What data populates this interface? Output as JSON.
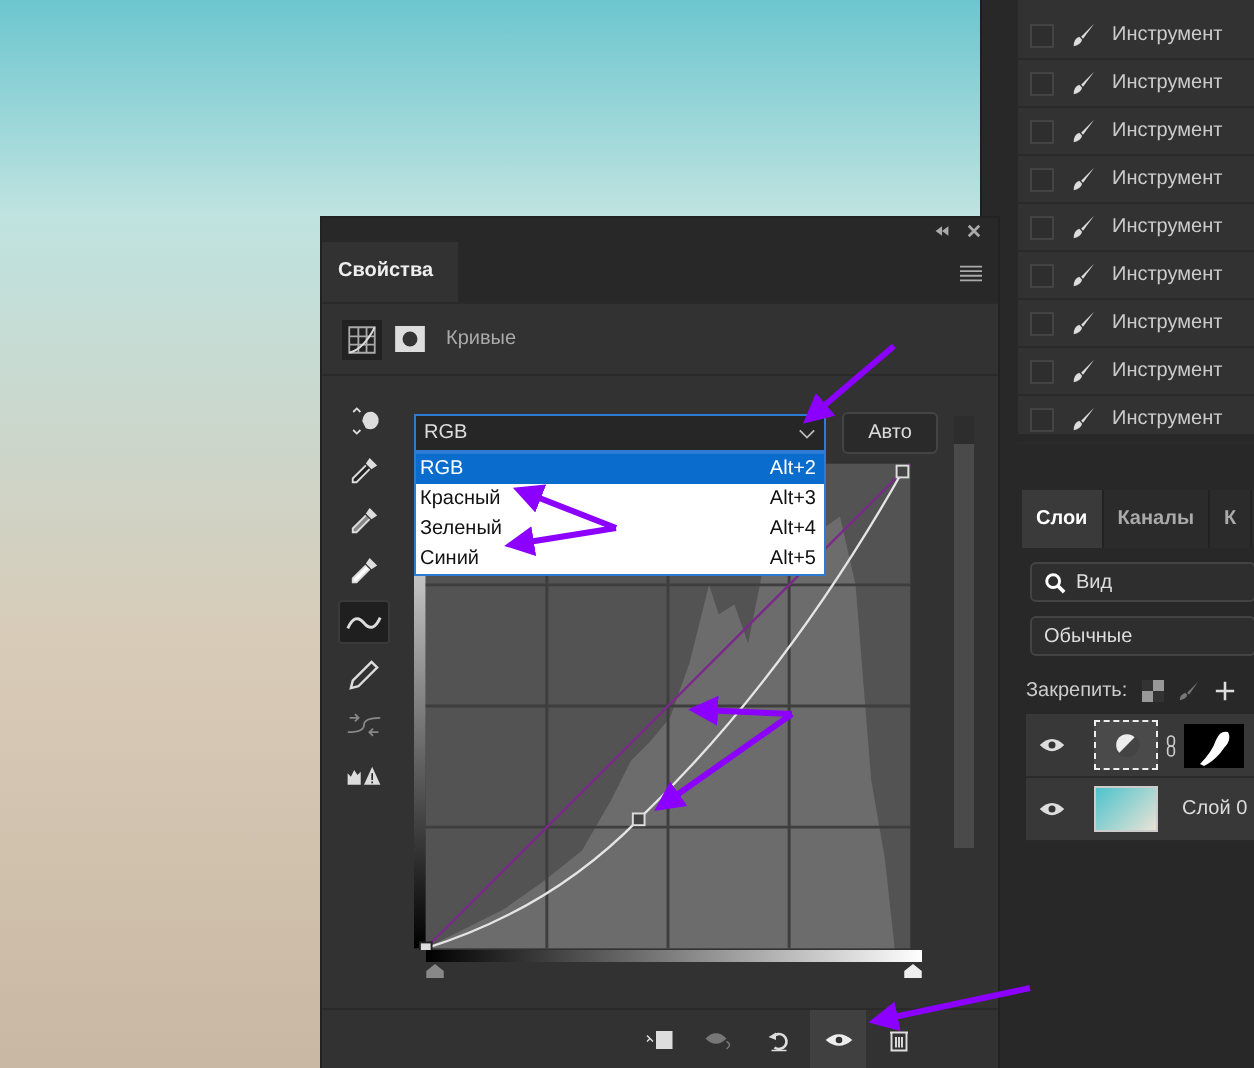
{
  "history": {
    "items": [
      {
        "label": "Инструмент",
        "checked": false
      },
      {
        "label": "Инструмент",
        "checked": false
      },
      {
        "label": "Инструмент",
        "checked": false
      },
      {
        "label": "Инструмент",
        "checked": false
      },
      {
        "label": "Инструмент",
        "checked": false
      },
      {
        "label": "Инструмент",
        "checked": false
      },
      {
        "label": "Инструмент",
        "checked": false
      },
      {
        "label": "Инструмент",
        "checked": false
      },
      {
        "label": "Инструмент",
        "checked": false
      }
    ]
  },
  "properties": {
    "title": "Свойства",
    "adjustment": "Кривые",
    "tools": [
      {
        "kind": "hand",
        "selected": false
      },
      {
        "kind": "dropper",
        "selected": false
      },
      {
        "kind": "dropper",
        "selected": false
      },
      {
        "kind": "dropper",
        "selected": false
      },
      {
        "kind": "curve",
        "selected": true
      },
      {
        "kind": "pencil",
        "selected": false
      },
      {
        "kind": "smooth",
        "selected": false
      },
      {
        "kind": "clip",
        "selected": false
      }
    ],
    "channel": {
      "value": "RGB",
      "expanded": true
    },
    "auto_button": "Авто",
    "input_sliders": [
      {
        "level": 0
      },
      {
        "level": 1
      }
    ],
    "channel_menu": [
      {
        "label": "RGB",
        "shortcut": "Alt+2",
        "selected": true
      },
      {
        "label": "Красный",
        "shortcut": "Alt+3",
        "selected": false
      },
      {
        "label": "Зеленый",
        "shortcut": "Alt+4",
        "selected": false
      },
      {
        "label": "Синий",
        "shortcut": "Alt+5",
        "selected": false
      }
    ],
    "footer_buttons": [
      {
        "kind": "clip",
        "selected": false
      },
      {
        "kind": "preview",
        "selected": false
      },
      {
        "kind": "reset",
        "selected": false
      },
      {
        "kind": "eye",
        "selected": true
      },
      {
        "kind": "trash",
        "selected": false
      }
    ]
  },
  "layers_panel": {
    "tabs": [
      {
        "label": "Слои",
        "selected": true
      },
      {
        "label": "Каналы",
        "selected": false
      },
      {
        "label": "К",
        "selected": false
      }
    ],
    "filter": "Вид",
    "blend_mode": "Обычные",
    "lock_label": "Закрепить:",
    "layers": [
      {
        "kind": "adjustment",
        "visible": true
      },
      {
        "kind": "image",
        "name": "Слой 0",
        "visible": true
      }
    ]
  }
}
